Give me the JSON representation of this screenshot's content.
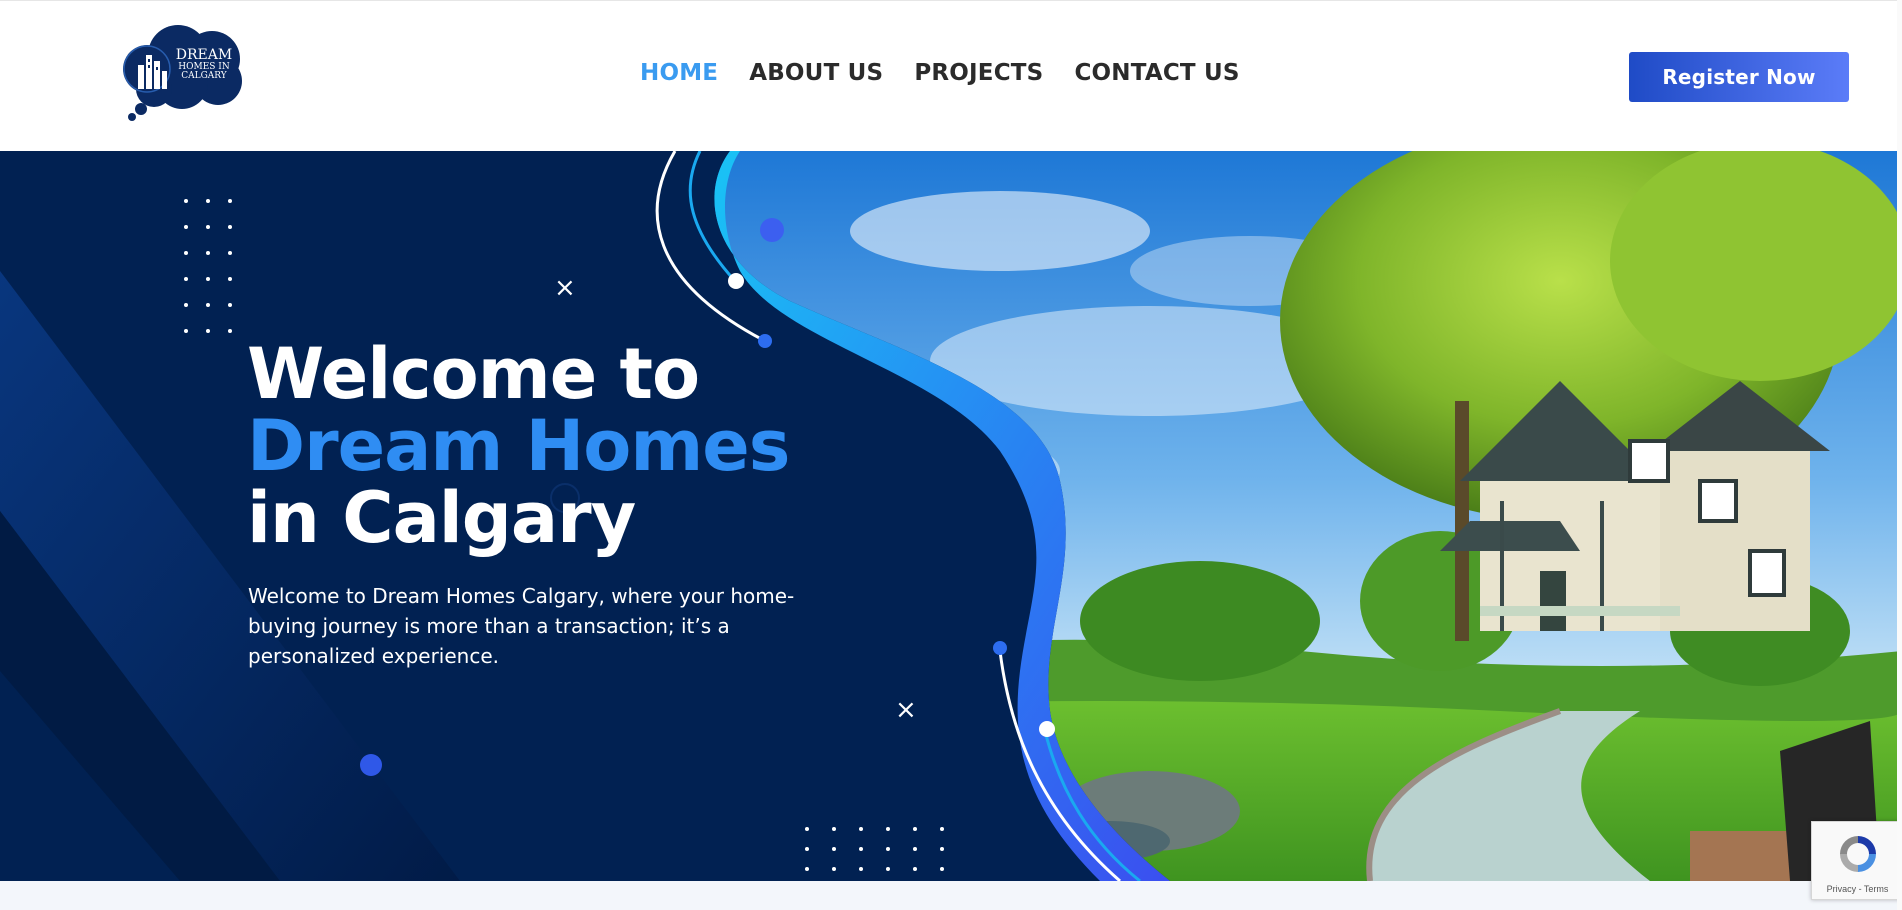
{
  "header": {
    "logo": {
      "line1": "DREAM",
      "line2": "HOMES IN",
      "line3": "CALGARY"
    },
    "nav": [
      {
        "label": "HOME",
        "active": true
      },
      {
        "label": "ABOUT US",
        "active": false
      },
      {
        "label": "PROJECTS",
        "active": false
      },
      {
        "label": "CONTACT US",
        "active": false
      }
    ],
    "register_label": "Register Now"
  },
  "hero": {
    "title_line1": "Welcome to",
    "title_line2": "Dream Homes",
    "title_line3": "in Calgary",
    "description": "Welcome to Dream Homes Calgary, where your home-buying journey is more than a transaction; it’s a personalized experience.",
    "decor": {
      "x_icon": "×"
    }
  },
  "recaptcha": {
    "icon": "recaptcha-icon",
    "text": "Privacy - Terms"
  },
  "colors": {
    "navy": "#012152",
    "accent_blue": "#2f8df3",
    "nav_active": "#3a9bf0",
    "button_start": "#1f4bc6",
    "button_end": "#5b7cf8"
  }
}
